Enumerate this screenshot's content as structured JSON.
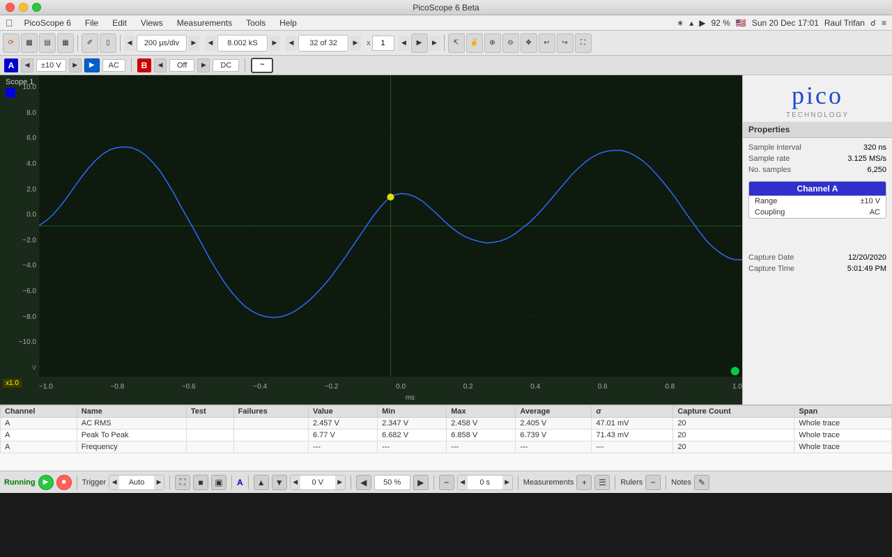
{
  "window": {
    "title": "PicoScope 6 Beta",
    "app_name": "PicoScope 6"
  },
  "menu": {
    "items": [
      "File",
      "Edit",
      "Views",
      "Measurements",
      "Tools",
      "Help"
    ]
  },
  "toolbar": {
    "timebase": "200 µs/div",
    "samples": "8.002 kS",
    "capture": "32 of 32",
    "x_value": "1"
  },
  "channels": {
    "channel_a": {
      "label": "A",
      "range": "±10 V",
      "coupling": "AC",
      "play_active": true
    },
    "channel_b": {
      "label": "B",
      "state": "Off",
      "coupling": "DC"
    }
  },
  "scope": {
    "title": "Scope 1",
    "y_labels": [
      "10.0",
      "8.0",
      "6.0",
      "4.0",
      "2.0",
      "0.0",
      "−2.0",
      "−4.0",
      "−6.0",
      "−8.0",
      "−10.0"
    ],
    "y_unit": "V",
    "x_labels": [
      "−1.0",
      "−0.8",
      "−0.6",
      "−0.4",
      "−0.2",
      "0.0",
      "0.2",
      "0.4",
      "0.6",
      "0.8",
      "1.0"
    ],
    "x_unit": "ms",
    "x_badge": "x1.0"
  },
  "properties": {
    "title": "Properties",
    "sample_interval_label": "Sample interval",
    "sample_interval_value": "320 ns",
    "sample_rate_label": "Sample rate",
    "sample_rate_value": "3.125 MS/s",
    "no_samples_label": "No. samples",
    "no_samples_value": "6,250",
    "channel_label": "Channel  A",
    "range_label": "Range",
    "range_value": "±10 V",
    "coupling_label": "Coupling",
    "coupling_value": "AC",
    "capture_date_label": "Capture Date",
    "capture_date_value": "12/20/2020",
    "capture_time_label": "Capture Time",
    "capture_time_value": "5:01:49 PM"
  },
  "pico_logo": {
    "text": "pico",
    "subtext": "Technology"
  },
  "measurements": {
    "headers": [
      "Channel",
      "Name",
      "Test",
      "Failures",
      "Value",
      "Min",
      "Max",
      "Average",
      "σ",
      "Capture Count",
      "Span"
    ],
    "rows": [
      [
        "A",
        "AC RMS",
        "",
        "",
        "2.457 V",
        "2.347 V",
        "2.458 V",
        "2.405 V",
        "47.01 mV",
        "20",
        "Whole trace"
      ],
      [
        "A",
        "Peak To Peak",
        "",
        "",
        "6.77 V",
        "6.682 V",
        "6.858 V",
        "6.739 V",
        "71.43 mV",
        "20",
        "Whole trace"
      ],
      [
        "A",
        "Frequency",
        "",
        "",
        "---",
        "---",
        "---",
        "---",
        "---",
        "20",
        "Whole trace"
      ]
    ]
  },
  "status_bar": {
    "running_label": "Running",
    "trigger_label": "Trigger",
    "trigger_mode": "Auto",
    "channel_a_label": "A",
    "zoom_level": "50 %",
    "time_value": "0 s",
    "measurements_label": "Measurements",
    "rulers_label": "Rulers",
    "notes_label": "Notes",
    "voltage_value": "0 V"
  }
}
